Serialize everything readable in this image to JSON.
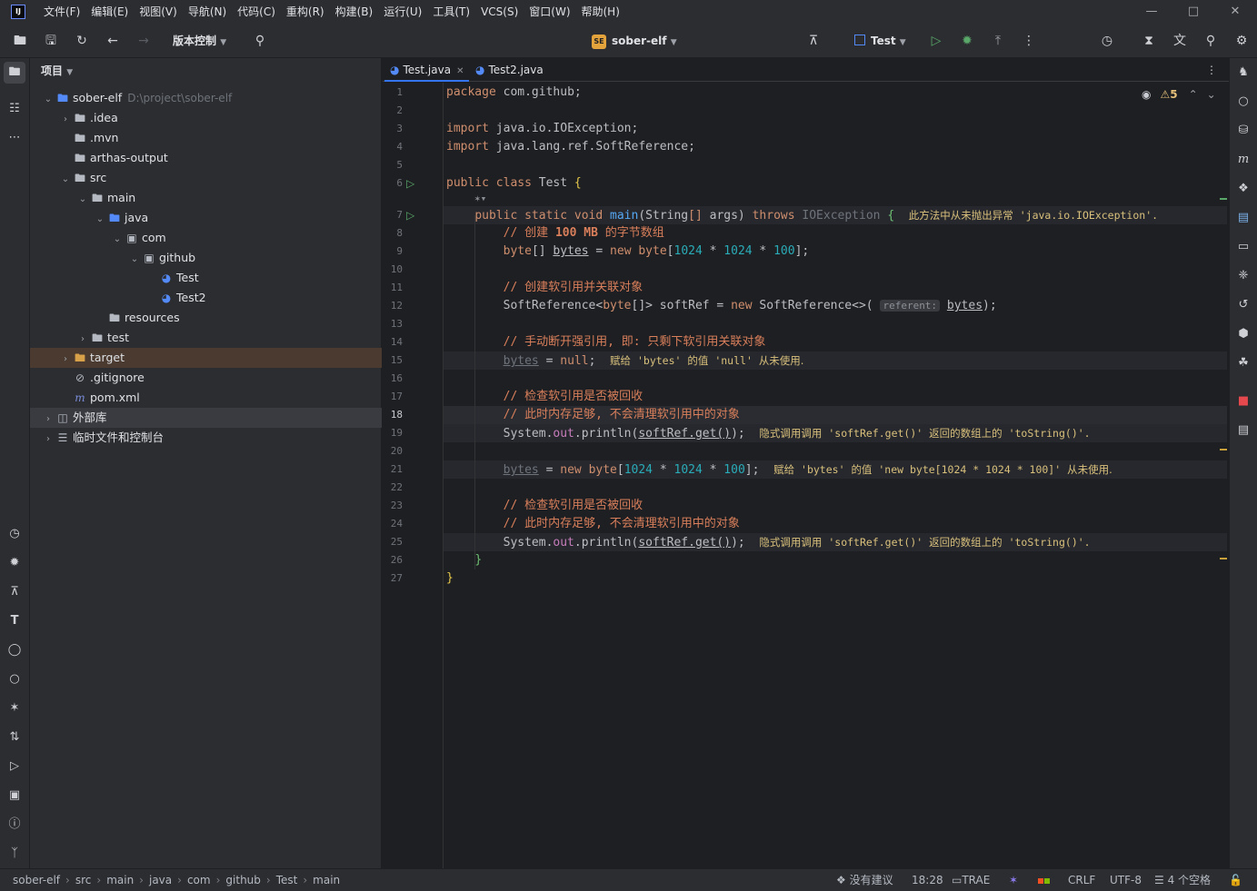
{
  "menu": [
    "文件(F)",
    "编辑(E)",
    "视图(V)",
    "导航(N)",
    "代码(C)",
    "重构(R)",
    "构建(B)",
    "运行(U)",
    "工具(T)",
    "VCS(S)",
    "窗口(W)",
    "帮助(H)"
  ],
  "app_logo": "IJ",
  "toolbar": {
    "vcs_label": "版本控制",
    "project_badge": "SE",
    "project_name": "sober-elf",
    "run_config": "Test"
  },
  "project_panel": {
    "title": "项目",
    "tree": [
      {
        "label": "sober-elf",
        "hint": "D:\\project\\sober-elf",
        "depth": 0,
        "expanded": true,
        "icon": "module-folder-icon"
      },
      {
        "label": ".idea",
        "depth": 1,
        "expanded": false,
        "icon": "folder-icon"
      },
      {
        "label": ".mvn",
        "depth": 1,
        "icon": "folder-icon"
      },
      {
        "label": "arthas-output",
        "depth": 1,
        "icon": "folder-icon"
      },
      {
        "label": "src",
        "depth": 1,
        "expanded": true,
        "icon": "folder-icon"
      },
      {
        "label": "main",
        "depth": 2,
        "expanded": true,
        "icon": "folder-icon"
      },
      {
        "label": "java",
        "depth": 3,
        "expanded": true,
        "icon": "source-folder-icon"
      },
      {
        "label": "com",
        "depth": 4,
        "expanded": true,
        "icon": "package-icon"
      },
      {
        "label": "github",
        "depth": 5,
        "expanded": true,
        "icon": "package-icon"
      },
      {
        "label": "Test",
        "depth": 6,
        "icon": "java-class-icon"
      },
      {
        "label": "Test2",
        "depth": 6,
        "icon": "java-class-icon"
      },
      {
        "label": "resources",
        "depth": 3,
        "icon": "resources-folder-icon"
      },
      {
        "label": "test",
        "depth": 2,
        "expanded": false,
        "icon": "folder-icon"
      },
      {
        "label": "target",
        "depth": 1,
        "expanded": false,
        "icon": "excluded-folder-icon"
      },
      {
        "label": ".gitignore",
        "depth": 1,
        "icon": "ignore-file-icon"
      },
      {
        "label": "pom.xml",
        "depth": 1,
        "icon": "maven-icon"
      },
      {
        "label": "外部库",
        "depth": 0,
        "expanded": false,
        "icon": "library-icon"
      },
      {
        "label": "临时文件和控制台",
        "depth": 0,
        "expanded": false,
        "icon": "scratches-icon"
      }
    ]
  },
  "tabs": [
    {
      "label": "Test.java",
      "active": true
    },
    {
      "label": "Test2.java",
      "active": false
    }
  ],
  "editor": {
    "warnings": "5",
    "current_line": 18,
    "line_numbers": [
      "1",
      "2",
      "3",
      "4",
      "5",
      "6",
      "7",
      "8",
      "9",
      "10",
      "11",
      "12",
      "13",
      "14",
      "15",
      "16",
      "17",
      "18",
      "19",
      "20",
      "21",
      "22",
      "23",
      "24",
      "25",
      "26",
      "27"
    ],
    "l1": "com.github;",
    "l3": "java.io.IOException;",
    "l4": "java.lang.ref.SoftReference;",
    "l6_name": "Test",
    "l7_exc": "IOException",
    "l7_note_cn": "此方法中从未抛出异常",
    "l7_note_code": "'java.io.IOException'.",
    "l8_comment_pre": "// 创建",
    "l8_comment_num": "100 MB",
    "l8_comment_post": "的字节数组",
    "l11_comment": "// 创建软引用并关联对象",
    "l12_inlay": "referent:",
    "l14_comment": "// 手动断开强引用, 即: 只剩下软引用关联对象",
    "l15_note_a": "赋给",
    "l15_note_b": "'bytes'",
    "l15_note_c": "的值",
    "l15_note_d": "'null'",
    "l15_note_e": "从未使用.",
    "l17_comment": "// 检查软引用是否被回收",
    "l18_comment": "// 此时内存足够, 不会清理软引用中的对象",
    "l19_note_a": "隐式调用调用",
    "l19_note_b": "'softRef.get()'",
    "l19_note_c": "返回的数组上的",
    "l19_note_d": "'toString()'.",
    "l21_note_a": "赋给",
    "l21_note_b": "'bytes'",
    "l21_note_c": "的值",
    "l21_note_d": "'new byte[1024 * 1024 * 100]'",
    "l21_note_e": "从未使用.",
    "l23_comment": "// 检查软引用是否被回收",
    "l24_comment": "// 此时内存足够, 不会清理软引用中的对象",
    "l25_note_a": "隐式调用调用",
    "l25_note_b": "'softRef.get()'",
    "l25_note_c": "返回的数组上的",
    "l25_note_d": "'toString()'."
  },
  "statusbar": {
    "breadcrumbs": [
      "sober-elf",
      "src",
      "main",
      "java",
      "com",
      "github",
      "Test",
      "main"
    ],
    "suggestions": "没有建议",
    "position": "18:28",
    "trae": "TRAE",
    "line_sep": "CRLF",
    "encoding": "UTF-8",
    "indent": "4 个空格"
  },
  "colors": {
    "accent": "#3574f0",
    "keyword": "#cf8e6d",
    "number": "#2aacb8",
    "warning": "#e5c07b"
  }
}
